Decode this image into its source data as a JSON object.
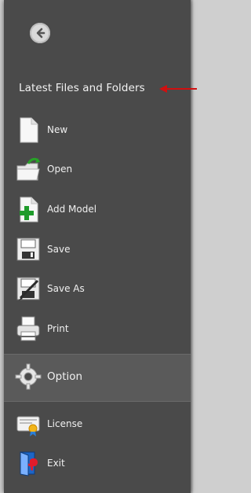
{
  "menu": {
    "section_title": "Latest Files and Folders",
    "items": [
      {
        "key": "new",
        "label": "New",
        "icon": "new-document-icon"
      },
      {
        "key": "open",
        "label": "Open",
        "icon": "open-folder-icon"
      },
      {
        "key": "add",
        "label": "Add Model",
        "icon": "add-model-icon"
      },
      {
        "key": "save",
        "label": "Save",
        "icon": "save-icon"
      },
      {
        "key": "saveas",
        "label": "Save As",
        "icon": "save-as-icon"
      },
      {
        "key": "print",
        "label": "Print",
        "icon": "printer-icon"
      },
      {
        "key": "option",
        "label": "Option",
        "icon": "gear-icon"
      },
      {
        "key": "license",
        "label": "License",
        "icon": "license-certificate-icon"
      },
      {
        "key": "exit",
        "label": "Exit",
        "icon": "exit-door-icon"
      }
    ]
  },
  "colors": {
    "panel_bg": "#4a4a4a",
    "option_band_bg": "#5a5a5a",
    "annotation_arrow": "#d01010"
  }
}
